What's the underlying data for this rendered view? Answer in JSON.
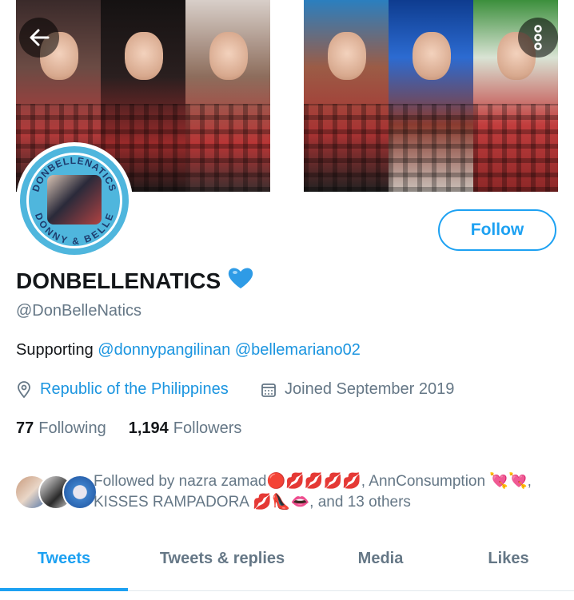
{
  "profile": {
    "name": "DONBELLENATICS",
    "handle": "@DonBelleNatics",
    "bio_prefix": "Supporting ",
    "bio_mention_1": "@donnypangilinan",
    "bio_mention_2": "@bellemariano02",
    "location": "Republic of the Philippines",
    "joined": "Joined September 2019",
    "avatar_text_top": "DONBELLENATICS",
    "avatar_text_bottom": "DONNY & BELLE",
    "verified_icon": "blue-heart-icon"
  },
  "actions": {
    "follow_label": "Follow",
    "back_icon": "back-arrow-icon",
    "more_icon": "more-vertical-icon"
  },
  "stats": {
    "following_count": "77",
    "following_label": "Following",
    "followers_count": "1,194",
    "followers_label": "Followers"
  },
  "followed_by": {
    "line1": "Followed by nazra zamad🔴💋💋💋💋, AnnConsumption 💘💘,",
    "line2": "KISSES RAMPADORA 💋👠👄, and 13 others"
  },
  "tabs": [
    {
      "label": "Tweets",
      "active": true
    },
    {
      "label": "Tweets & replies",
      "active": false
    },
    {
      "label": "Media",
      "active": false
    },
    {
      "label": "Likes",
      "active": false
    }
  ],
  "colors": {
    "accent": "#1da1f2",
    "secondary_text": "#657786",
    "link": "#1b95e0"
  }
}
